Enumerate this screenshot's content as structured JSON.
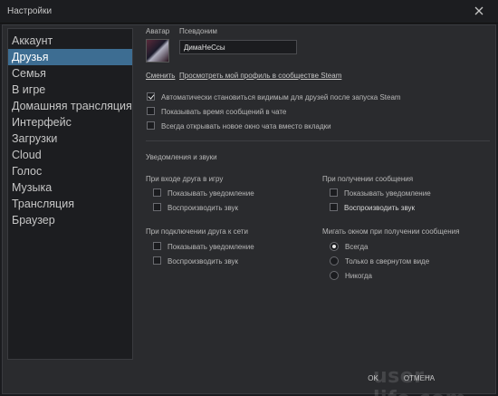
{
  "window": {
    "title": "Настройки"
  },
  "sidebar": {
    "items": [
      {
        "label": "Аккаунт"
      },
      {
        "label": "Друзья"
      },
      {
        "label": "Семья"
      },
      {
        "label": "В игре"
      },
      {
        "label": "Домашняя трансляция"
      },
      {
        "label": "Интерфейс"
      },
      {
        "label": "Загрузки"
      },
      {
        "label": "Cloud"
      },
      {
        "label": "Голос"
      },
      {
        "label": "Музыка"
      },
      {
        "label": "Трансляция"
      },
      {
        "label": "Браузер"
      }
    ],
    "active_index": 1
  },
  "profile": {
    "avatar_label": "Аватар",
    "nickname_label": "Псевдоним",
    "nickname_value": "ДимаНеСсы",
    "change_link": "Сменить",
    "view_profile_link": "Просмотреть мой профиль в сообществе Steam"
  },
  "options": [
    {
      "label": "Автоматически становиться видимым для друзей после запуска Steam",
      "checked": true
    },
    {
      "label": "Показывать время сообщений в чате",
      "checked": false
    },
    {
      "label": "Всегда открывать новое окно чата вместо вкладки",
      "checked": false
    }
  ],
  "notifications": {
    "section_title": "Уведомления и звуки",
    "friend_joins_game": {
      "title": "При входе друга в игру",
      "show_notification": "Показывать уведомление",
      "play_sound": "Воспроизводить звук"
    },
    "message_received": {
      "title": "При получении сообщения",
      "show_notification": "Показывать уведомление",
      "play_sound": "Воспроизводить звук"
    },
    "friend_online": {
      "title": "При подключении друга к сети",
      "show_notification": "Показывать уведомление",
      "play_sound": "Воспроизводить звук"
    },
    "flash_window": {
      "title": "Мигать окном при получении сообщения",
      "options": [
        "Всегда",
        "Только в свернутом виде",
        "Никогда"
      ],
      "selected_index": 0
    }
  },
  "footer": {
    "ok_label": "OK",
    "cancel_label": "ОТМЕНА"
  },
  "watermark": "user-life.com"
}
